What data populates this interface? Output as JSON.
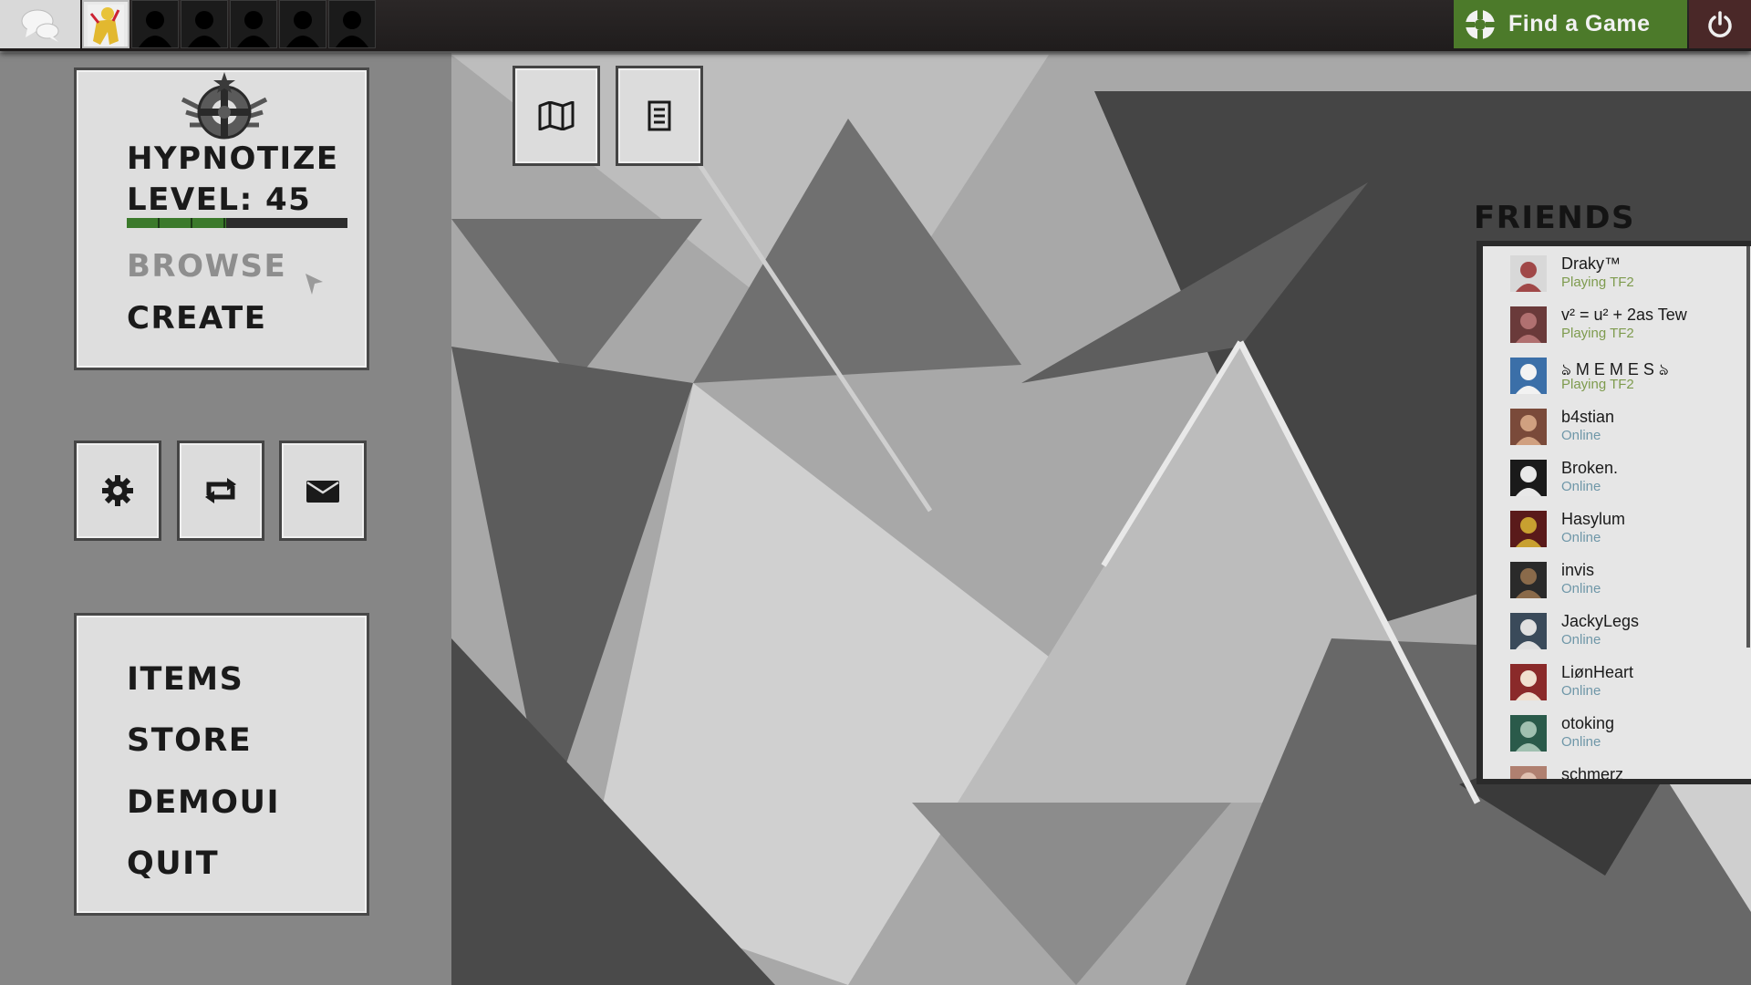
{
  "colors": {
    "accent_green": "#4c7a2a",
    "power_bg": "#4a2828",
    "status_in_game": "#7e9b4e",
    "status_online": "#6f97a8"
  },
  "topbar": {
    "find_game_label": "Find a Game",
    "chat_icon": "chat-bubbles-icon",
    "power_icon": "power-icon",
    "party_slots": 6
  },
  "profile": {
    "name": "HYPNOTIZE",
    "level_label": "LEVEL: 45",
    "xp_progress": 0.45,
    "browse_label": "BROWSE",
    "create_label": "CREATE"
  },
  "quick_buttons": [
    "gear-icon",
    "refresh-icon",
    "mail-icon"
  ],
  "top_buttons": [
    "map-icon",
    "notes-icon"
  ],
  "menu": {
    "items_label": "ITEMS",
    "store_label": "STORE",
    "demoui_label": "DEMOUI",
    "quit_label": "QUIT"
  },
  "friends": {
    "title": "FRIENDS",
    "list": [
      {
        "name": "Draky™",
        "status": "Playing TF2",
        "state": "game"
      },
      {
        "name": "v² = u² + 2as Tew",
        "status": "Playing TF2",
        "state": "game"
      },
      {
        "name": "ঌ M E M E S ঌ",
        "status": "Playing TF2",
        "state": "game"
      },
      {
        "name": "b4stian",
        "status": "Online",
        "state": "online"
      },
      {
        "name": "Broken.",
        "status": "Online",
        "state": "online"
      },
      {
        "name": "Hasylum",
        "status": "Online",
        "state": "online"
      },
      {
        "name": "invis",
        "status": "Online",
        "state": "online"
      },
      {
        "name": "JackyLegs",
        "status": "Online",
        "state": "online"
      },
      {
        "name": "LiønHeart",
        "status": "Online",
        "state": "online"
      },
      {
        "name": "otoking",
        "status": "Online",
        "state": "online"
      },
      {
        "name": "schmerz",
        "status": "",
        "state": "online"
      }
    ]
  }
}
